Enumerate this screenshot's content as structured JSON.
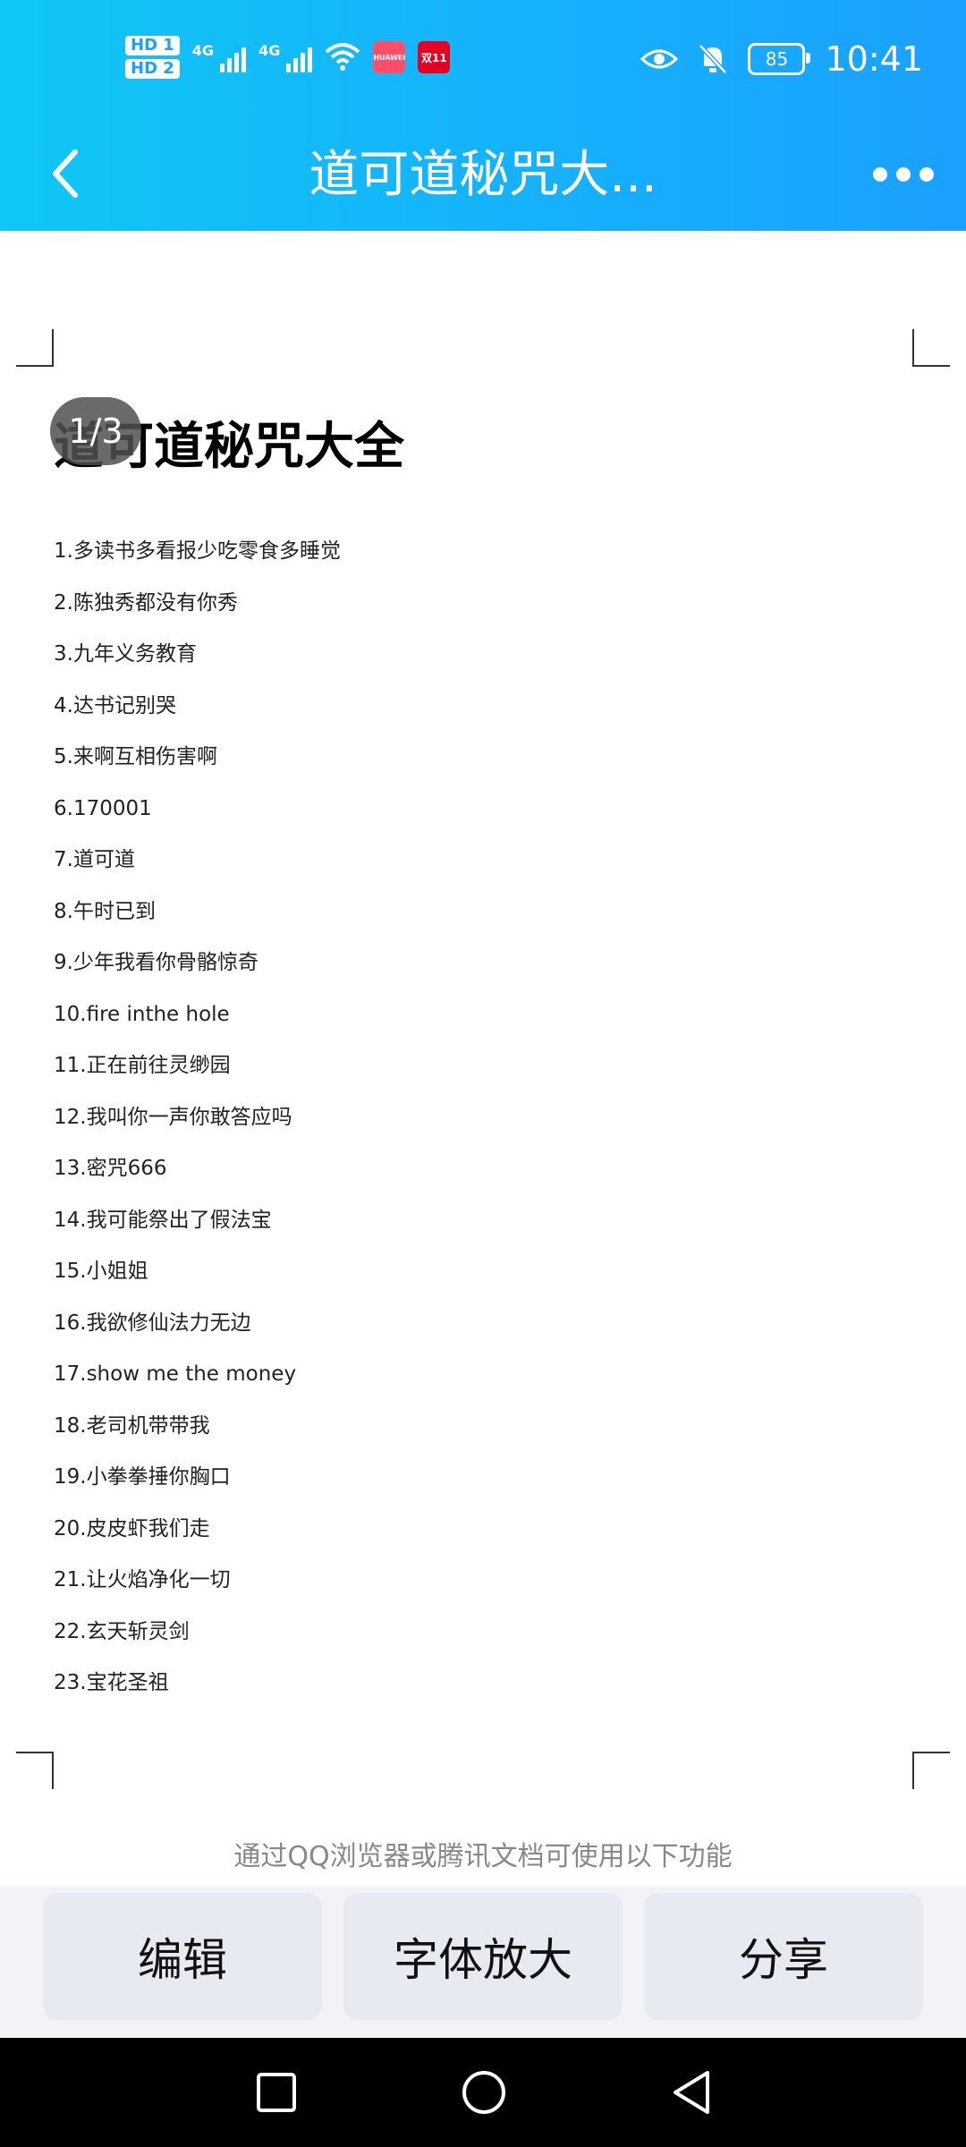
{
  "status_bar": {
    "hd_labels": [
      "HD 1",
      "HD 2"
    ],
    "network_1": "4G",
    "network_2": "4G",
    "app_badges": [
      "HUAWEI",
      "双11"
    ],
    "battery": "85",
    "time": "10:41"
  },
  "header": {
    "title": "道可道秘咒大..."
  },
  "document": {
    "page_indicator": "1/3",
    "title": "道可道秘咒大全",
    "items": [
      "1.多读书多看报少吃零食多睡觉",
      "2.陈独秀都没有你秀",
      "3.九年义务教育",
      "4.达书记别哭",
      "5.来啊互相伤害啊",
      "6.170001",
      "7.道可道",
      "8.午时已到",
      "9.少年我看你骨骼惊奇",
      "10.fire inthe hole",
      "11.正在前往灵缈园",
      "12.我叫你一声你敢答应吗",
      "13.密咒666",
      "14.我可能祭出了假法宝",
      "15.小姐姐",
      "16.我欲修仙法力无边",
      "17.show me the money",
      "18.老司机带带我",
      "19.小拳拳捶你胸口",
      "20.皮皮虾我们走",
      "21.让火焰净化一切",
      "22.玄天斩灵剑",
      "23.宝花圣祖"
    ]
  },
  "footer": {
    "hint": "通过QQ浏览器或腾讯文档可使用以下功能",
    "edit_label": "编辑",
    "font_label": "字体放大",
    "share_label": "分享"
  },
  "icons": {
    "back": "back-chevron-icon",
    "more": "more-dots-icon",
    "wifi": "wifi-icon",
    "eye": "eye-icon",
    "mute": "bell-off-icon"
  }
}
